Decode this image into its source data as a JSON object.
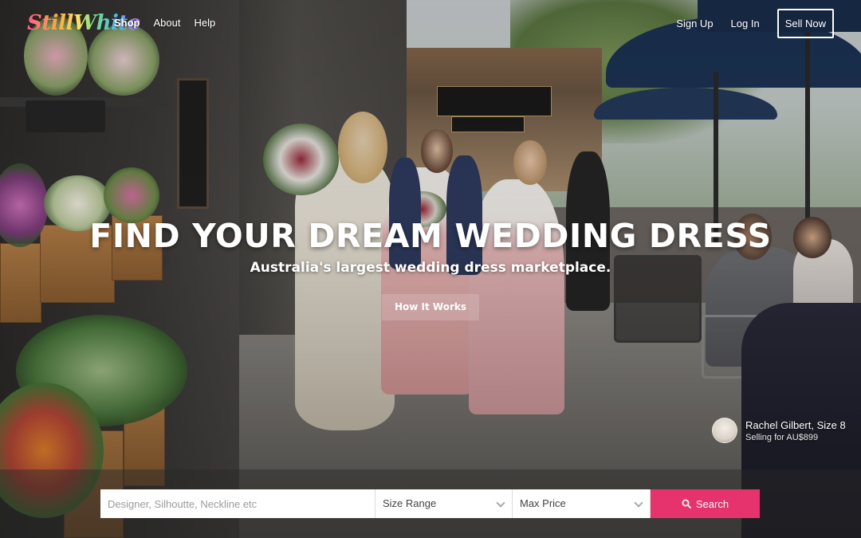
{
  "brand": {
    "logo_text": "StillWhite"
  },
  "nav": {
    "left": [
      {
        "label": "Shop",
        "active": true
      },
      {
        "label": "About",
        "active": false
      },
      {
        "label": "Help",
        "active": false
      }
    ],
    "sign_up": "Sign Up",
    "log_in": "Log In",
    "sell_now": "Sell Now"
  },
  "hero": {
    "title": "FIND YOUR DREAM WEDDING DRESS",
    "subtitle": "Australia's largest wedding dress marketplace.",
    "how_it_works": "How It Works"
  },
  "photo_credit": {
    "name": "Rachel Gilbert, Size 8",
    "price": "Selling for AU$899"
  },
  "search": {
    "placeholder": "Designer, Silhoutte, Neckline etc",
    "size_select": "Size Range",
    "price_select": "Max Price",
    "button": "Search",
    "icon": "search-icon"
  },
  "colors": {
    "accent": "#e6336d"
  }
}
